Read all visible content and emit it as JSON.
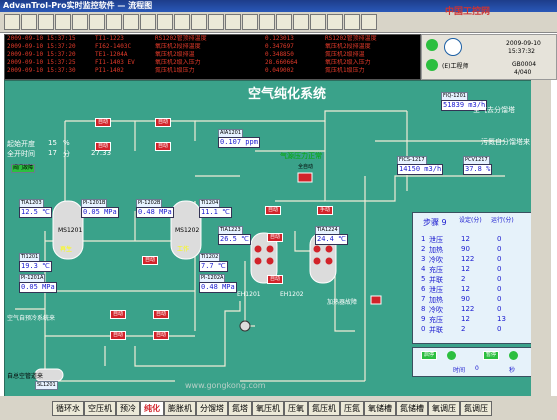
{
  "window": {
    "title": "AdvanTrol-Pro实时监控软件 — 流程图"
  },
  "toolbar": {
    "buttons": [
      "toolbar-1",
      "toolbar-2",
      "toolbar-3",
      "toolbar-4",
      "toolbar-5",
      "toolbar-6",
      "toolbar-7",
      "toolbar-8",
      "toolbar-9",
      "toolbar-10",
      "toolbar-11",
      "toolbar-12",
      "toolbar-13",
      "toolbar-14",
      "toolbar-15",
      "toolbar-16",
      "toolbar-17",
      "toolbar-18",
      "toolbar-19",
      "toolbar-20",
      "toolbar-21",
      "toolbar-22"
    ]
  },
  "alarms": [
    {
      "time": "2009-09-10 15:37:15",
      "tag": "TI1-1223",
      "desc": "RS1202管顶排温度",
      "value": "0.123013"
    },
    {
      "time": "2009-09-10 15:37:20",
      "tag": "FI62-1403C",
      "desc": "氧压机2段排温度",
      "value": "0.347697"
    },
    {
      "time": "2009-09-10 15:37:20",
      "tag": "TE1-1204A",
      "desc": "氧压机2级排温",
      "value": "0.348850"
    },
    {
      "time": "2009-09-10 15:37:25",
      "tag": "FI1-1403 EV",
      "desc": "氧压机2级入压力",
      "value": "28.660664"
    },
    {
      "time": "2009-09-10 15:37:30",
      "tag": "PI1-1402",
      "desc": "氮压机1级压力",
      "value": "0.049002"
    }
  ],
  "alarm_right": [
    "RS1202管顶排温度",
    "氧压机2段排温度",
    "氮压机2级排温",
    "氧压机2级入压力",
    "氮压机1级压力"
  ],
  "side": {
    "date": "2009-09-10",
    "time": "15:37:32",
    "user": "(E)工程师",
    "code": "GB0004",
    "page": "4/040"
  },
  "hmi": {
    "title": "空气纯化系统",
    "fiq": {
      "tag": "FIQ-1201",
      "value": "51839",
      "unit": "m3/h"
    },
    "to_air": "空气去分馏塔",
    "n2_back": "污氮自分馏塔来",
    "fic": {
      "tag": "FICS-1217",
      "value": "14150",
      "unit": "m3/h"
    },
    "pcv": {
      "tag": "PCV1217",
      "value": "37.8",
      "unit": "%"
    },
    "aia": {
      "tag": "AIA1201",
      "value": "0.107",
      "unit": "ppm"
    },
    "gas_normal": "气源压力正常",
    "quan_auto": "全自动",
    "heater_fault": "加热器故障",
    "left_labels": [
      "起始开度",
      "全开时间"
    ],
    "left_vals": [
      "15",
      "17"
    ],
    "left_units": [
      "%",
      "分"
    ],
    "valve_fault": "阀门故障",
    "flow_2733": "27.33",
    "ti1203": {
      "tag": "TIA1203",
      "value": "12.5",
      "unit": "℃"
    },
    "pi1201b": {
      "tag": "PI-1201B",
      "value": "0.05",
      "unit": "MPa"
    },
    "pi1202b": {
      "tag": "PI-1202B",
      "value": "0.48",
      "unit": "MPa"
    },
    "ti1204": {
      "tag": "TI1204",
      "value": "11.1",
      "unit": "℃"
    },
    "ti1201": {
      "tag": "TI1201",
      "value": "19.3",
      "unit": "℃"
    },
    "pi1201a": {
      "tag": "PI-1201A",
      "value": "0.05",
      "unit": "MPa"
    },
    "ti1202": {
      "tag": "TI1202",
      "value": "7.7",
      "unit": "℃"
    },
    "pi1202a": {
      "tag": "PI-1202A",
      "value": "0.48",
      "unit": "MPa"
    },
    "tia1223": {
      "tag": "TIA1223",
      "value": "26.5",
      "unit": "℃"
    },
    "tia1224": {
      "tag": "TIA1224",
      "value": "24.4",
      "unit": "℃"
    },
    "ms1201": "MS1201",
    "ms1202": "MS1202",
    "regen": "再生",
    "work": "工作",
    "eh1201": "EH1201",
    "eh1202": "EH1202",
    "auto": "自动",
    "manual": "手动",
    "sl1201": "SL1201",
    "main_air": "自总空管道来",
    "from_cooler": "空气自预冷系统来",
    "lowerleft": "至消声",
    "valves": [
      "V1203",
      "V1204",
      "V1201",
      "V1202",
      "V1207",
      "V1208",
      "V1209",
      "V1210",
      "V1211",
      "V1212",
      "V1213",
      "V1214",
      "V1215",
      "V1216",
      "V1217",
      "V1218",
      "V1219",
      "V1220",
      "V1221",
      "V1222",
      "V1223",
      "V1224",
      "V1225",
      "V1226"
    ]
  },
  "steps": {
    "title": "步骤",
    "current": "9",
    "headers": [
      "设定(分)",
      "运行(分)"
    ],
    "rows": [
      {
        "n": "1",
        "name": "泄压",
        "set": "12",
        "run": "0"
      },
      {
        "n": "2",
        "name": "加热",
        "set": "90",
        "run": "0"
      },
      {
        "n": "3",
        "name": "冷吹",
        "set": "122",
        "run": "0"
      },
      {
        "n": "4",
        "name": "充压",
        "set": "12",
        "run": "0"
      },
      {
        "n": "5",
        "name": "并联",
        "set": "2",
        "run": "0"
      },
      {
        "n": "6",
        "name": "泄压",
        "set": "12",
        "run": "0"
      },
      {
        "n": "7",
        "name": "加热",
        "set": "90",
        "run": "0"
      },
      {
        "n": "8",
        "name": "冷吹",
        "set": "122",
        "run": "0"
      },
      {
        "n": "9",
        "name": "充压",
        "set": "12",
        "run": "13"
      },
      {
        "n": "0",
        "name": "并联",
        "set": "2",
        "run": "0"
      }
    ],
    "start": "启停",
    "pause": "暂停",
    "time_label": "时间",
    "time_val": "0",
    "time_unit": "秒"
  },
  "nav": [
    "循环水",
    "空压机",
    "预冷",
    "纯化",
    "膨胀机",
    "分馏塔",
    "氮塔",
    "氧压机",
    "压氧",
    "氮压机",
    "压氮",
    "氧储槽",
    "氮储槽",
    "氧调压",
    "氮调压"
  ],
  "nav_active": "纯化",
  "watermark": "www.gongkong.com",
  "logo": "中国工控网",
  "colors": {
    "hmi_bg": "#3aa28a",
    "pipe": "#e8e8d0",
    "alarm": "#e23a2a",
    "active": "#d2232a"
  }
}
